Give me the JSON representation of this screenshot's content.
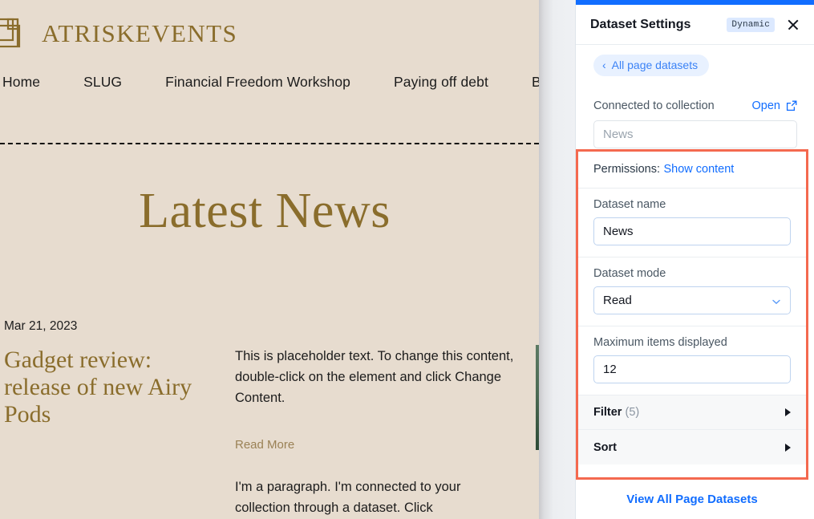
{
  "site": {
    "brand": "ATRISKEVENTS",
    "logo_icon": "overlapping-squares-logo-icon",
    "nav_items": [
      {
        "label": "Home"
      },
      {
        "label": "SLUG"
      },
      {
        "label": "Financial Freedom Workshop"
      },
      {
        "label": "Paying off debt"
      },
      {
        "label": "Book Online"
      }
    ],
    "section_heading": "Latest News",
    "post": {
      "date": "Mar 21, 2023",
      "title": "Gadget review: release of new Airy Pods",
      "body": "This is placeholder text. To change this content, double-click on the element and click Change Content.",
      "read_more": "Read More",
      "body2": "I'm a paragraph. I'm connected to your collection through a dataset. Click"
    },
    "colors": {
      "background": "#e7dccf",
      "accent_gold": "#8a6d2c",
      "scrollbar_green": "#2d4a35"
    }
  },
  "panel": {
    "title": "Dataset Settings",
    "badge": "Dynamic",
    "close_icon": "close-icon",
    "back_pill": {
      "label": "All page datasets",
      "icon": "chevron-left-icon"
    },
    "connected": {
      "label": "Connected to collection",
      "open_label": "Open",
      "open_icon": "external-link-icon",
      "collection_value": "News"
    },
    "permissions": {
      "label": "Permissions:",
      "link": "Show content"
    },
    "dataset_name": {
      "label": "Dataset name",
      "value": "News"
    },
    "dataset_mode": {
      "label": "Dataset mode",
      "value": "Read",
      "caret_icon": "chevron-down-icon"
    },
    "max_items": {
      "label": "Maximum items displayed",
      "value": "12"
    },
    "filter_row": {
      "label": "Filter",
      "count": "(5)",
      "icon": "triangle-right-icon"
    },
    "sort_row": {
      "label": "Sort",
      "icon": "triangle-right-icon"
    },
    "view_all_label": "View All Page Datasets",
    "colors": {
      "topbar_blue": "#116dff",
      "link_blue": "#116dff",
      "highlight_border": "#f4694f",
      "badge_bg": "#dce9ff"
    }
  }
}
